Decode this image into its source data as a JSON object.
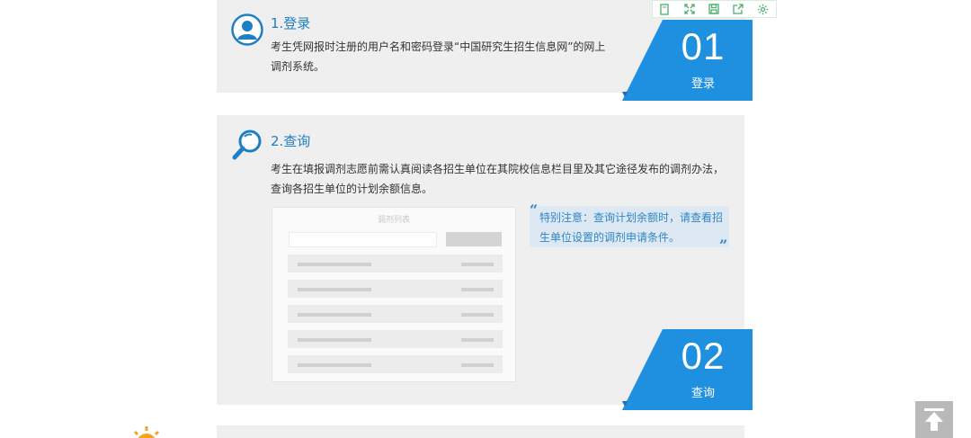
{
  "toolbar": {
    "icons": [
      "copy-icon",
      "fullscreen-icon",
      "save-icon",
      "share-icon",
      "settings-icon"
    ]
  },
  "steps": [
    {
      "title": "1.登录",
      "description": "考生凭网报时注册的用户名和密码登录“中国研究生招生信息网”的网上调剂系统。",
      "badge_number": "01",
      "badge_label": "登录",
      "icon": "user-icon"
    },
    {
      "title": "2.查询",
      "description": "考生在填报调剂志愿前需认真阅读各招生单位在其院校信息栏目里及其它途径发布的调剂办法，查询各招生单位的计划余额信息。",
      "badge_number": "02",
      "badge_label": "查询",
      "icon": "search-icon"
    }
  ],
  "mock_list": {
    "title": "调剂列表",
    "row_count": 5
  },
  "note": {
    "text": "特别注意：查询计划余额时，请查看招生单位设置的调剂申请条件。"
  },
  "colors": {
    "accent": "#1e7fc4",
    "badge_blue": "#1f8fdf",
    "card_bg": "#efefef",
    "note_bg": "#dde8f2"
  }
}
